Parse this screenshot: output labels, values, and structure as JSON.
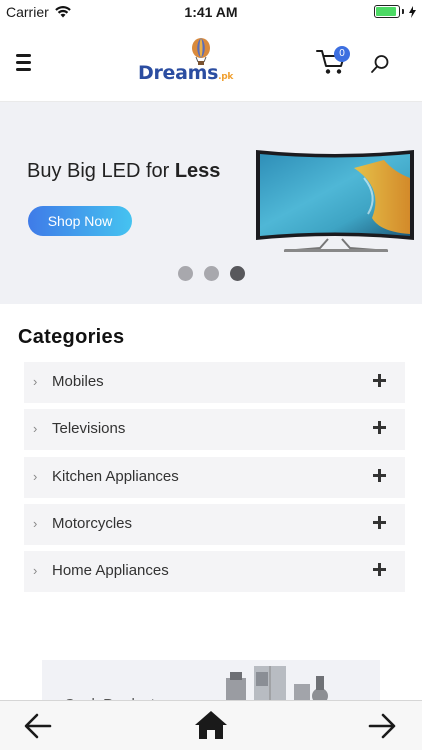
{
  "status_bar": {
    "carrier": "Carrier",
    "time": "1:41 AM",
    "battery_level": 0.9,
    "icons": [
      "wifi-icon",
      "battery-icon",
      "charging-icon"
    ]
  },
  "header": {
    "logo_text": "Dreams",
    "logo_suffix": ".pk",
    "cart_count": "0",
    "icons": [
      "menu-icon",
      "cart-icon",
      "search-icon"
    ],
    "brand_color": "#2b4da1",
    "badge_color": "#3d6fe0"
  },
  "banner": {
    "title_prefix": "Buy Big LED for ",
    "title_bold": "Less",
    "cta_label": "Shop Now",
    "slide_count": 3,
    "active_slide": 3,
    "cta_gradient": [
      "#3f7be8",
      "#45c3f0"
    ]
  },
  "categories": {
    "title": "Categories",
    "items": [
      {
        "label": "Mobiles"
      },
      {
        "label": "Televisions"
      },
      {
        "label": "Kitchen Appliances"
      },
      {
        "label": "Motorcycles"
      },
      {
        "label": "Home Appliances"
      }
    ]
  },
  "promo": {
    "text": "Cook Product"
  },
  "bottom_nav": {
    "icons": [
      "back-arrow-icon",
      "home-icon",
      "forward-arrow-icon"
    ]
  }
}
